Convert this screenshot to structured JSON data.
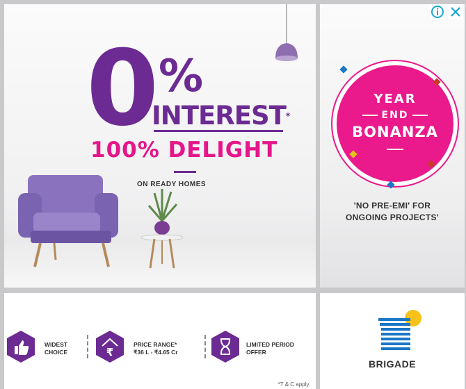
{
  "colors": {
    "purple": "#6c2b93",
    "pink": "#e4168a",
    "badge": "#ea1a8c",
    "blue": "#1b77c6",
    "yellow": "#f6c21b"
  },
  "hero": {
    "zero": "0",
    "percent": "%",
    "interest": "INTEREST",
    "interest_mark": "*",
    "delight": "100% DELIGHT",
    "ready_homes": "ON READY HOMES"
  },
  "badge": {
    "year": "YEAR",
    "end": "END",
    "bonanza": "BONANZA"
  },
  "offer": {
    "line1": "'NO PRE-EMI' FOR",
    "line2": "ONGOING PROJECTS'"
  },
  "features": [
    {
      "icon": "thumbs-up-icon",
      "line1": "WIDEST",
      "line2": "CHOICE"
    },
    {
      "icon": "rupee-house-icon",
      "line1": "PRICE RANGE*",
      "line2": "₹36 L - ₹4.65 Cr"
    },
    {
      "icon": "hourglass-icon",
      "line1": "LIMITED PERIOD",
      "line2": "OFFER"
    }
  ],
  "terms": "*T & C apply.",
  "brand": {
    "name": "BRIGADE"
  },
  "ad_controls": {
    "info_icon": "info-icon",
    "close_icon": "close-icon"
  }
}
